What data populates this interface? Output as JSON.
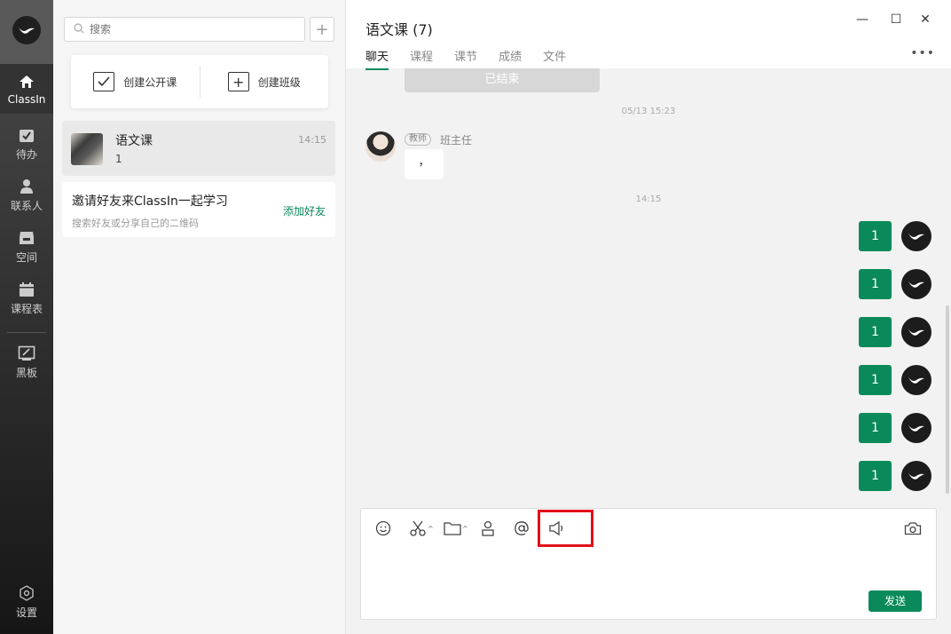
{
  "app": {
    "name": "ClassIn"
  },
  "rail": {
    "items": [
      {
        "label": "ClassIn",
        "icon": "home-icon"
      },
      {
        "label": "待办",
        "icon": "todo-icon"
      },
      {
        "label": "联系人",
        "icon": "contacts-icon"
      },
      {
        "label": "空间",
        "icon": "space-icon"
      },
      {
        "label": "课程表",
        "icon": "calendar-icon"
      },
      {
        "label": "黑板",
        "icon": "blackboard-icon"
      }
    ],
    "settings_label": "设置"
  },
  "sidebar": {
    "search_placeholder": "搜索",
    "add_symbol": "+",
    "create_public_label": "创建公开课",
    "create_class_label": "创建班级",
    "conversation": {
      "title": "语文课",
      "preview": "1",
      "time": "14:15"
    },
    "invite": {
      "title": "邀请好友来ClassIn一起学习",
      "subtitle": "搜索好友或分享自己的二维码",
      "action": "添加好友"
    }
  },
  "chat": {
    "title": "语文课 (7)",
    "tabs": [
      "聊天",
      "课程",
      "课节",
      "成绩",
      "文件"
    ],
    "more": "•••",
    "ended_label": "已结束",
    "timestamp_1": "05/13 15:23",
    "teacher_tag": "教师",
    "teacher_name": "班主任",
    "teacher_message": "，",
    "timestamp_2": "14:15",
    "my_messages": [
      "1",
      "1",
      "1",
      "1",
      "1",
      "1"
    ],
    "send_label": "发送"
  },
  "window": {
    "minimize": "—",
    "maximize": "☐",
    "close": "✕"
  },
  "colors": {
    "accent": "#0a8a5a",
    "highlight": "#e2101a"
  }
}
